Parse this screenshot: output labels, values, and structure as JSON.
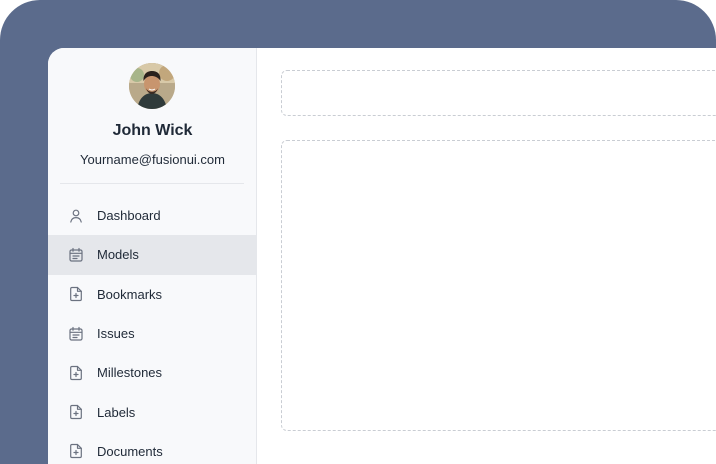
{
  "profile": {
    "name": "John Wick",
    "email": "Yourname@fusionui.com"
  },
  "sidebar": {
    "items": [
      {
        "label": "Dashboard",
        "icon": "user-icon",
        "active": false
      },
      {
        "label": "Models",
        "icon": "calendar-list-icon",
        "active": true
      },
      {
        "label": "Bookmarks",
        "icon": "file-plus-icon",
        "active": false
      },
      {
        "label": "Issues",
        "icon": "calendar-list-icon",
        "active": false
      },
      {
        "label": "Millestones",
        "icon": "file-plus-icon",
        "active": false
      },
      {
        "label": "Labels",
        "icon": "file-plus-icon",
        "active": false
      },
      {
        "label": "Documents",
        "icon": "file-plus-icon",
        "active": false
      }
    ]
  },
  "colors": {
    "frame": "#5b6b8c",
    "sidebar_bg": "#f8f9fb",
    "active_item_bg": "#e5e7eb",
    "text": "#1f2937",
    "icon": "#6b7280"
  }
}
